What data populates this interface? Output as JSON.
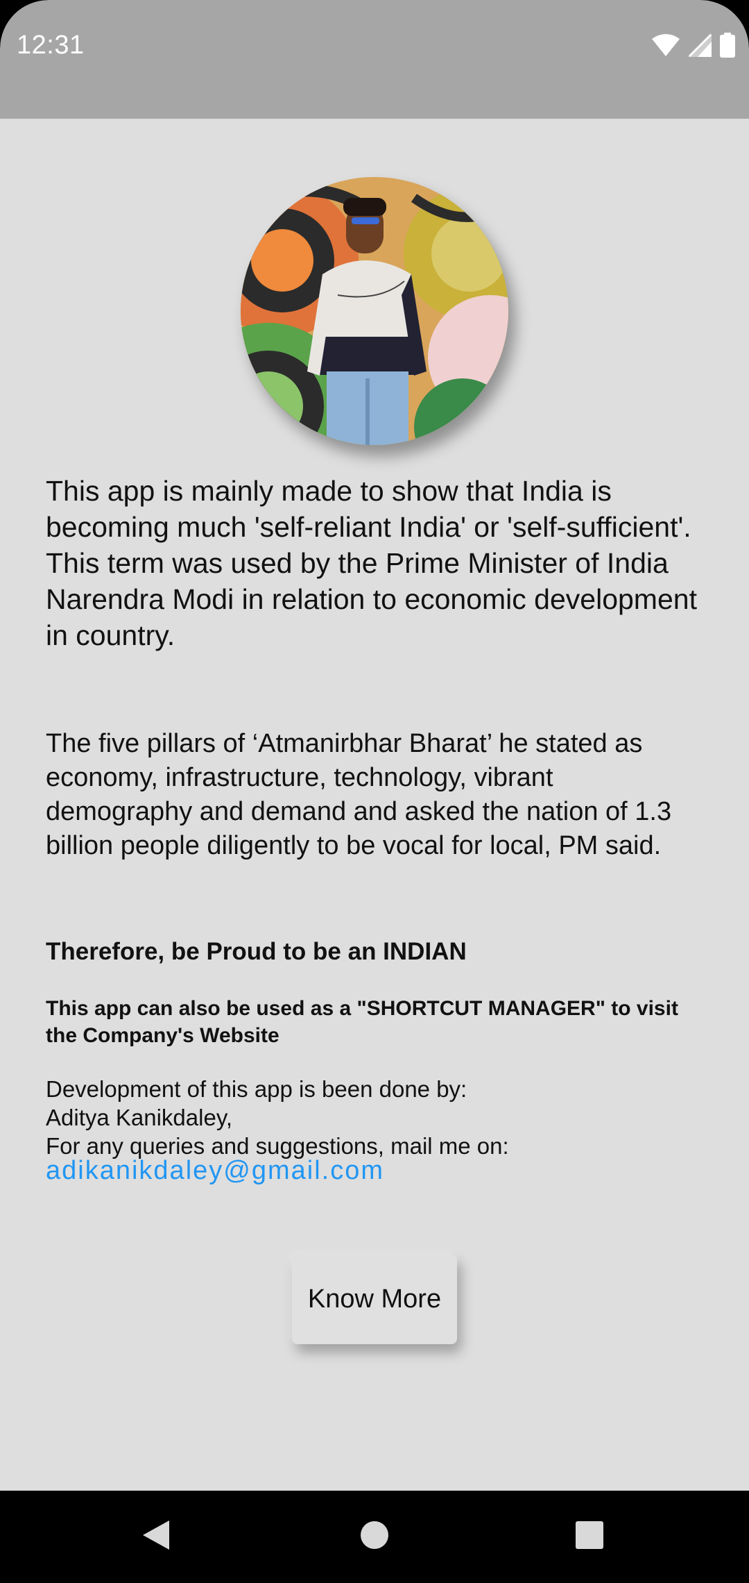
{
  "status_bar": {
    "time": "12:31",
    "icons": [
      "wifi-icon",
      "cellular-signal-icon",
      "battery-icon"
    ]
  },
  "profile": {
    "image_icon": "profile-photo"
  },
  "content": {
    "intro": "This app is mainly made to show that India is becoming much 'self-reliant India' or 'self-sufficient'.\nThis term was used by the Prime Minister of India Narendra Modi in relation to economic development in country.",
    "pillars": "The five pillars of ‘Atmanirbhar Bharat’ he stated as economy, infrastructure, technology, vibrant demography and demand and asked the nation of 1.3 billion people diligently to be vocal for local, PM said.",
    "proud": "Therefore, be Proud to be an INDIAN",
    "shortcut": "This app can also be used as a \"SHORTCUT MANAGER\" to visit the Company's Website",
    "dev_line1": "Development of this app is been done by:",
    "dev_line2": "Aditya Kanikdaley,",
    "dev_line3": "For any queries and suggestions, mail me on:",
    "email": "adikanikdaley@gmail.com"
  },
  "actions": {
    "know_more_label": "Know More"
  },
  "nav_bar": {
    "buttons": [
      "back-icon",
      "home-icon",
      "recents-icon"
    ]
  },
  "colors": {
    "status_bar_bg": "#a6a6a6",
    "content_bg": "#dedede",
    "link": "#2196f3",
    "nav_bar_bg": "#000000"
  }
}
